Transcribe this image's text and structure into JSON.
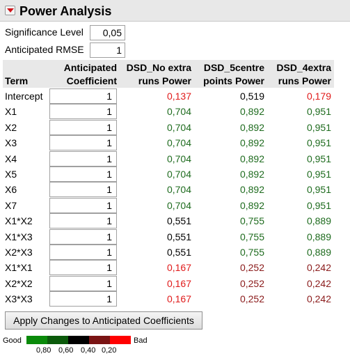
{
  "header": {
    "title": "Power Analysis",
    "disclosure_icon": "red-down-triangle"
  },
  "settings": {
    "significance_label": "Significance Level",
    "significance_value": "0,05",
    "rmse_label": "Anticipated RMSE",
    "rmse_value": "1"
  },
  "table": {
    "headers": {
      "term": "Term",
      "coef_line1": "Anticipated",
      "coef_line2": "Coefficient",
      "c1_line1": "DSD_No extra",
      "c1_line2": "runs Power",
      "c2_line1": "DSD_5centre",
      "c2_line2": "points Power",
      "c3_line1": "DSD_4extra",
      "c3_line2": "runs Power"
    },
    "rows": [
      {
        "term": "Intercept",
        "coef": "1",
        "c1": "0,137",
        "c2": "0,519",
        "c3": "0,179"
      },
      {
        "term": "X1",
        "coef": "1",
        "c1": "0,704",
        "c2": "0,892",
        "c3": "0,951"
      },
      {
        "term": "X2",
        "coef": "1",
        "c1": "0,704",
        "c2": "0,892",
        "c3": "0,951"
      },
      {
        "term": "X3",
        "coef": "1",
        "c1": "0,704",
        "c2": "0,892",
        "c3": "0,951"
      },
      {
        "term": "X4",
        "coef": "1",
        "c1": "0,704",
        "c2": "0,892",
        "c3": "0,951"
      },
      {
        "term": "X5",
        "coef": "1",
        "c1": "0,704",
        "c2": "0,892",
        "c3": "0,951"
      },
      {
        "term": "X6",
        "coef": "1",
        "c1": "0,704",
        "c2": "0,892",
        "c3": "0,951"
      },
      {
        "term": "X7",
        "coef": "1",
        "c1": "0,704",
        "c2": "0,892",
        "c3": "0,951"
      },
      {
        "term": "X1*X2",
        "coef": "1",
        "c1": "0,551",
        "c2": "0,755",
        "c3": "0,889"
      },
      {
        "term": "X1*X3",
        "coef": "1",
        "c1": "0,551",
        "c2": "0,755",
        "c3": "0,889"
      },
      {
        "term": "X2*X3",
        "coef": "1",
        "c1": "0,551",
        "c2": "0,755",
        "c3": "0,889"
      },
      {
        "term": "X1*X1",
        "coef": "1",
        "c1": "0,167",
        "c2": "0,252",
        "c3": "0,242"
      },
      {
        "term": "X2*X2",
        "coef": "1",
        "c1": "0,167",
        "c2": "0,252",
        "c3": "0,242"
      },
      {
        "term": "X3*X3",
        "coef": "1",
        "c1": "0,167",
        "c2": "0,252",
        "c3": "0,242"
      }
    ]
  },
  "apply_button": "Apply Changes to Anticipated Coefficients",
  "legend": {
    "good": "Good",
    "bad": "Bad",
    "ticks": [
      "0,80",
      "0,60",
      "0,40",
      "0,20"
    ],
    "colors": [
      "#0a8a0a",
      "#0b5a0b",
      "#000000",
      "#7a1414",
      "#ff0000"
    ]
  },
  "value_colors": {
    "good": "#1e6b1e",
    "neutral": "#000000",
    "low": "#8a1a1a",
    "bad": "#e01a1a"
  }
}
